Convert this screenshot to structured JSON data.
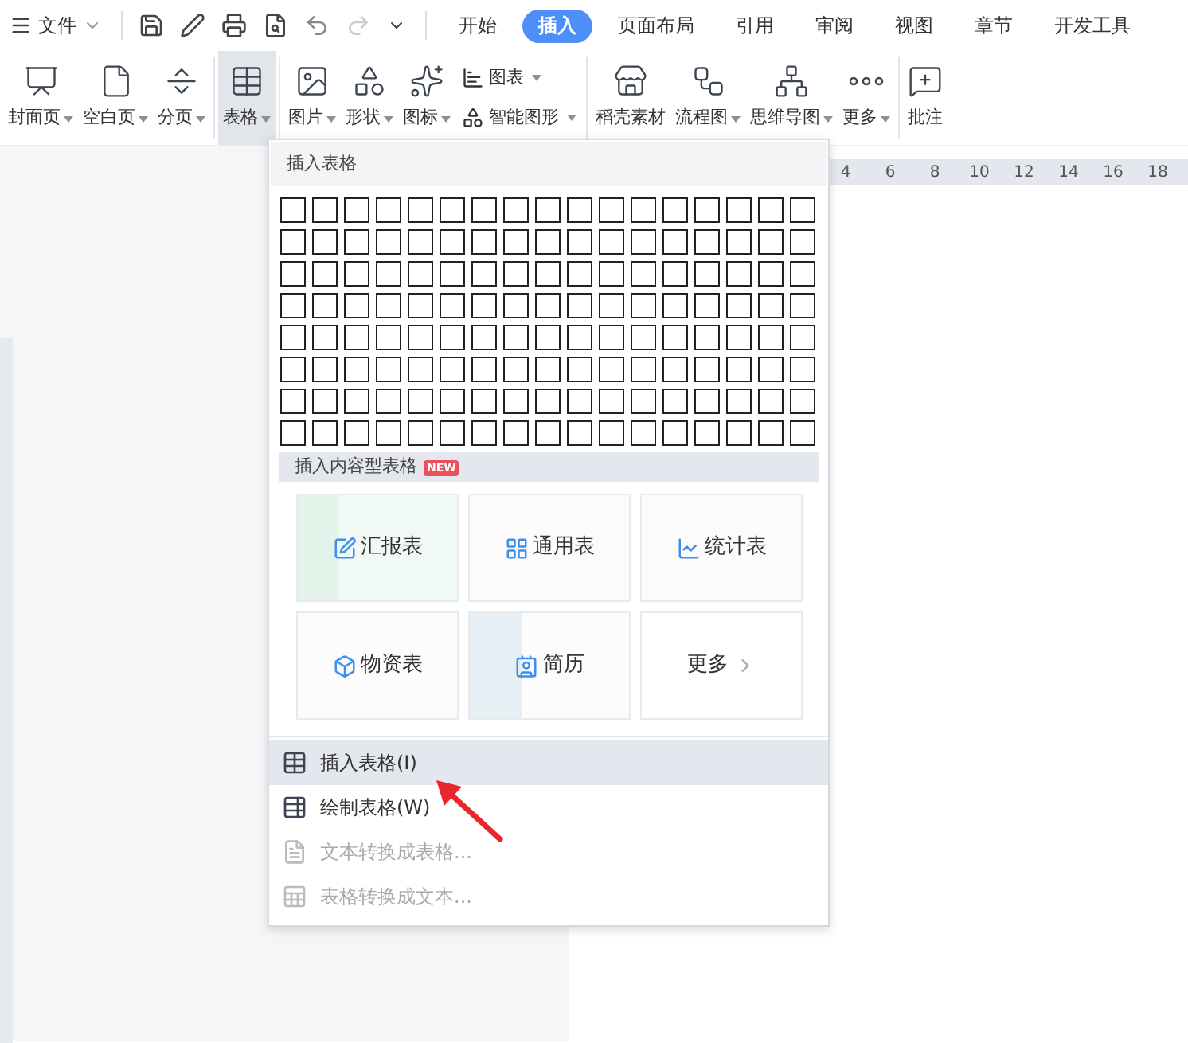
{
  "top_bar": {
    "file_menu": "文件",
    "tabs": [
      {
        "label": "开始",
        "selected": false
      },
      {
        "label": "插入",
        "selected": true
      },
      {
        "label": "页面布局",
        "selected": false
      },
      {
        "label": "引用",
        "selected": false
      },
      {
        "label": "审阅",
        "selected": false
      },
      {
        "label": "视图",
        "selected": false
      },
      {
        "label": "章节",
        "selected": false
      },
      {
        "label": "开发工具",
        "selected": false
      }
    ]
  },
  "ribbon": [
    {
      "kind": "cover",
      "label": "封面页",
      "dropdown": true,
      "active": false
    },
    {
      "kind": "blank",
      "label": "空白页",
      "dropdown": true,
      "active": false
    },
    {
      "kind": "break",
      "label": "分页",
      "dropdown": true,
      "active": false
    },
    {
      "kind": "table",
      "label": "表格",
      "dropdown": true,
      "active": true
    },
    {
      "kind": "picture",
      "label": "图片",
      "dropdown": true,
      "active": false
    },
    {
      "kind": "shape",
      "label": "形状",
      "dropdown": true,
      "active": false
    },
    {
      "kind": "iconlib",
      "label": "图标",
      "dropdown": true,
      "active": false
    },
    {
      "kind": "pair",
      "items": [
        {
          "kind": "chart",
          "label": "图表"
        },
        {
          "kind": "smart",
          "label": "智能图形"
        }
      ]
    },
    {
      "kind": "store",
      "label": "稻壳素材",
      "dropdown": false,
      "active": false
    },
    {
      "kind": "flow",
      "label": "流程图",
      "dropdown": true,
      "active": false
    },
    {
      "kind": "mind",
      "label": "思维导图",
      "dropdown": true,
      "active": false
    },
    {
      "kind": "more",
      "label": "更多",
      "dropdown": true,
      "active": false
    },
    {
      "kind": "comment",
      "label": "批注",
      "dropdown": false,
      "active": false
    }
  ],
  "ruler": [
    "4",
    "6",
    "8",
    "10",
    "12",
    "14",
    "16",
    "18"
  ],
  "table_menu": {
    "title": "插入表格",
    "content_tables": {
      "title": "插入内容型表格",
      "badge": "NEW",
      "templates": [
        {
          "kind": "report",
          "label": "汇报表"
        },
        {
          "kind": "general",
          "label": "通用表"
        },
        {
          "kind": "stats",
          "label": "统计表"
        },
        {
          "kind": "materials",
          "label": "物资表"
        },
        {
          "kind": "resume",
          "label": "简历"
        },
        {
          "kind": "more",
          "label": "更多"
        }
      ]
    },
    "items": [
      {
        "kind": "insert",
        "label": "插入表格(I)",
        "selected": true,
        "disabled": false
      },
      {
        "kind": "draw",
        "label": "绘制表格(W)",
        "selected": false,
        "disabled": false
      },
      {
        "kind": "text2table",
        "label": "文本转换成表格...",
        "selected": false,
        "disabled": true
      },
      {
        "kind": "table2text",
        "label": "表格转换成文本...",
        "selected": false,
        "disabled": true
      }
    ]
  }
}
